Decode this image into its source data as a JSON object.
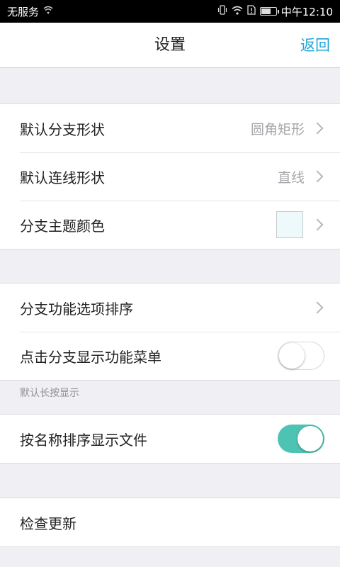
{
  "status_bar": {
    "carrier": "无服务",
    "time": "中午12:10"
  },
  "nav": {
    "title": "设置",
    "back_label": "返回"
  },
  "group1": {
    "branch_shape": {
      "label": "默认分支形状",
      "value": "圆角矩形"
    },
    "line_shape": {
      "label": "默认连线形状",
      "value": "直线"
    },
    "theme_color": {
      "label": "分支主题颜色",
      "swatch_color": "#eef9fb"
    }
  },
  "group2": {
    "option_order": {
      "label": "分支功能选项排序"
    },
    "click_menu": {
      "label": "点击分支显示功能菜单",
      "toggle": "off"
    },
    "note": "默认长按显示"
  },
  "group3": {
    "sort_by_name": {
      "label": "按名称排序显示文件",
      "toggle": "on"
    }
  },
  "group4": {
    "check_update": {
      "label": "检查更新"
    }
  },
  "colors": {
    "accent": "#1fa5d9",
    "toggle_on": "#4cc3b3",
    "background": "#efeff4"
  }
}
